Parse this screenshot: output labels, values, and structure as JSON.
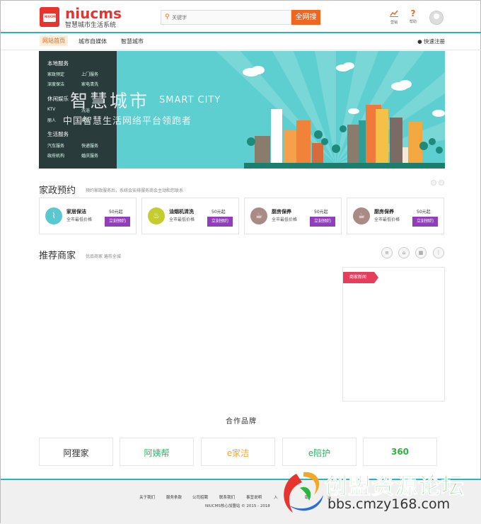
{
  "header": {
    "logo_badge": "NIUCMS",
    "logo_name": "niucms",
    "logo_sub": "智慧城市生活系统",
    "search_placeholder": "关键字",
    "search_button": "全网搜",
    "icons": [
      {
        "name": "chart-icon",
        "label": "营销"
      },
      {
        "name": "help-icon",
        "label": "帮助"
      }
    ]
  },
  "nav": {
    "items": [
      "网站首页",
      "城市自媒体",
      "智慧城市"
    ],
    "register": "快速注册"
  },
  "banner": {
    "title_cn": "智慧城市",
    "title_en": "SMART CITY",
    "subtitle": "中国智慧生活网络平台领跑者",
    "groups": [
      {
        "title": "本地服务",
        "items": [
          "家政预定",
          "上门服务",
          "深度保洁",
          "家电清洗"
        ]
      },
      {
        "title": "休闲娱乐",
        "items": [
          "KTV",
          "洗浴",
          "丽人",
          "景点"
        ]
      },
      {
        "title": "生活服务",
        "items": [
          "汽车服务",
          "快递服务",
          "政府机构",
          "婚庆服务"
        ]
      }
    ]
  },
  "housekeeping": {
    "title": "家政预约",
    "desc": "预约家政服务后，系统会安排服务商会主动和您联系",
    "cards": [
      {
        "name": "家居保洁",
        "desc": "全市最低价格",
        "price": "50元起",
        "button": "立刻预约",
        "icon": "broom-icon",
        "color": "#5bc8cf"
      },
      {
        "name": "油烟机清洗",
        "desc": "全市最低价格",
        "price": "50元起",
        "button": "立刻预约",
        "icon": "hood-icon",
        "color": "#c4cc2e"
      },
      {
        "name": "厨房保养",
        "desc": "全市最低价格",
        "price": "50元起",
        "button": "立刻预约",
        "icon": "pot-icon",
        "color": "#a98a84"
      },
      {
        "name": "厨房保养",
        "desc": "全市最低价格",
        "price": "50元起",
        "button": "立刻预约",
        "icon": "pot-icon",
        "color": "#a98a84"
      }
    ]
  },
  "merchants": {
    "title": "推荐商家",
    "desc": "优品商家 遍布全城",
    "news_tag": "商家新闻"
  },
  "partners": {
    "title": "合作品牌",
    "brands": [
      {
        "label": "阿狸家",
        "color": "#333"
      },
      {
        "label": "阿姨帮",
        "color": "#2bb56a"
      },
      {
        "label": "e家洁",
        "color": "#f5a623"
      },
      {
        "label": "e陪护",
        "color": "#2bb56a"
      },
      {
        "label": "360",
        "color": "#2bb53c"
      }
    ]
  },
  "footer": {
    "links": [
      "关于我们",
      "服务条款",
      "公司招聘",
      "联系我们",
      "事宜说明",
      "入",
      "助",
      "注"
    ],
    "copyright": "NIUCMS核心加盟站 © 2015 - 2018"
  },
  "watermark": {
    "title": "创盟资源论坛",
    "url": "bbs.cmzy168.com"
  }
}
